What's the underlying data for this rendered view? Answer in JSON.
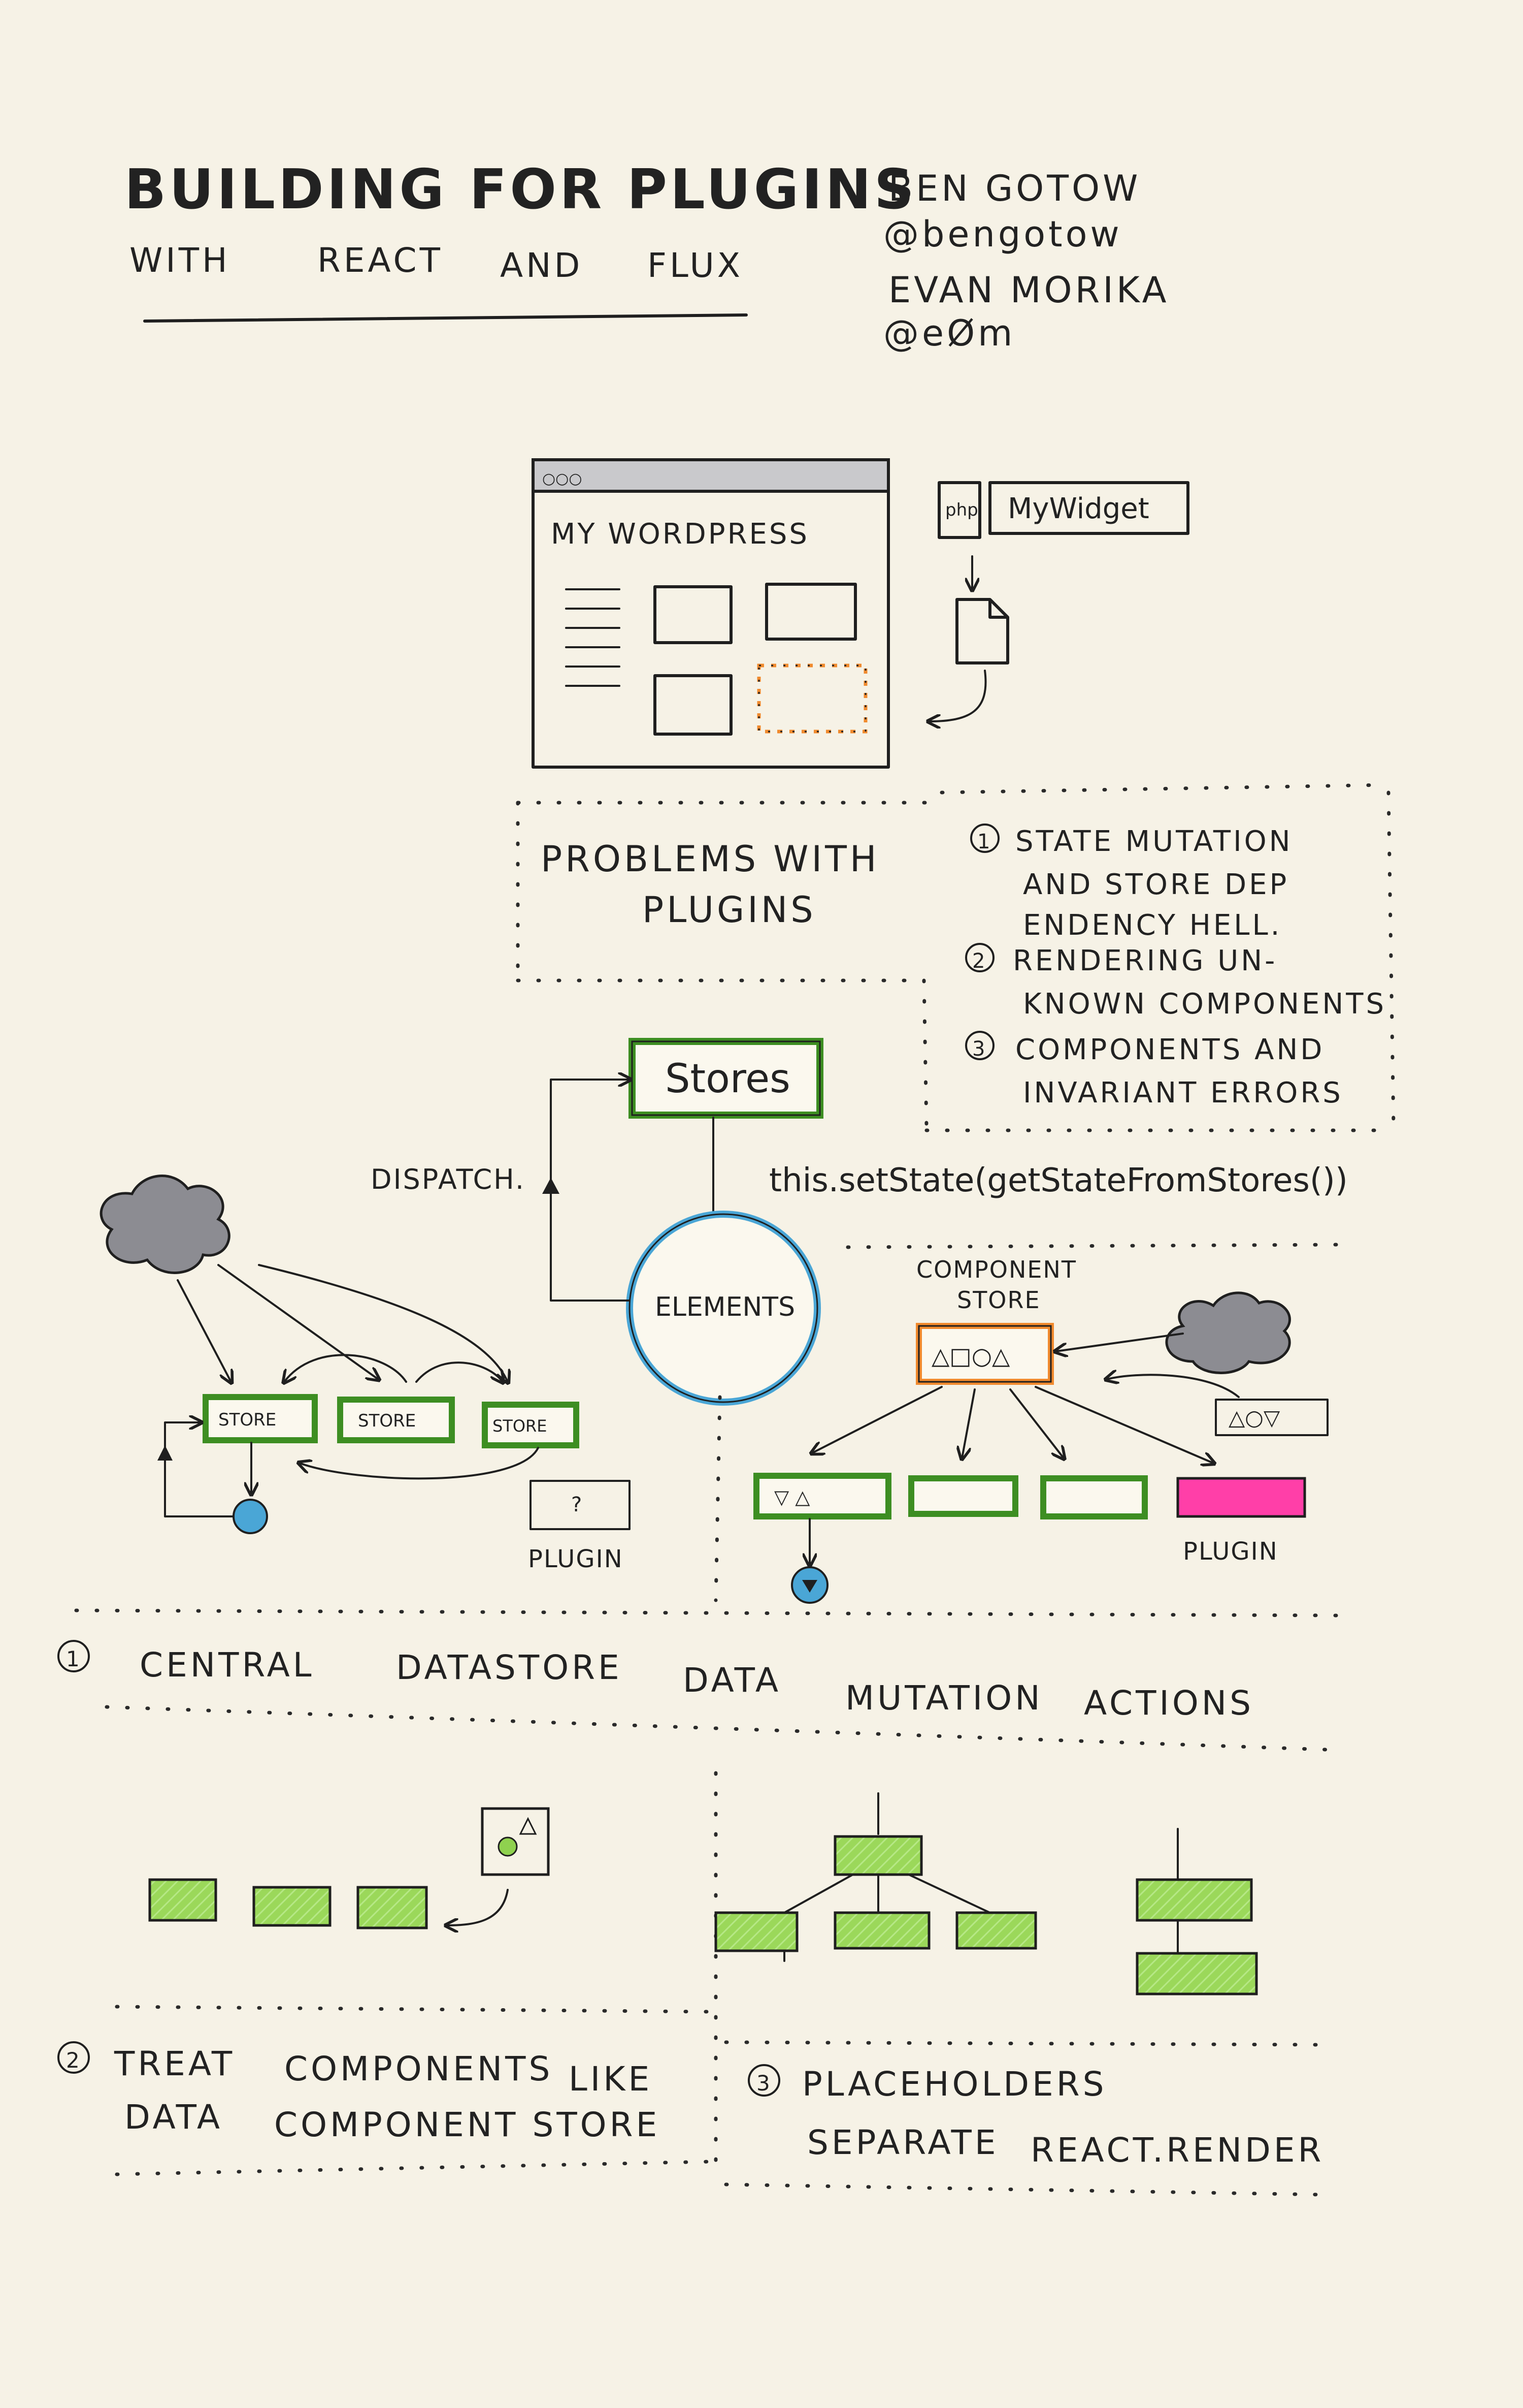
{
  "header": {
    "title": "BUILDING FOR PLUGINS",
    "subtitle_words": [
      "WITH",
      "REACT",
      "AND",
      "FLUX"
    ],
    "authors": [
      {
        "name": "BEN GOTOW",
        "handle": "@bengotow"
      },
      {
        "name": "EVAN MORIKA",
        "handle": "@eØm"
      }
    ]
  },
  "wordpress": {
    "window_title": "MY WORDPRESS",
    "window_dots": "○○○",
    "php_tag": "php",
    "widget_label": "MyWidget"
  },
  "problems": {
    "title_line1": "PROBLEMS WITH",
    "title_line2": "PLUGINS",
    "items": [
      {
        "num": "1",
        "lines": [
          "STATE MUTATION",
          "AND STORE DEP",
          "ENDENCY HELL."
        ]
      },
      {
        "num": "2",
        "lines": [
          "RENDERING UN-",
          "KNOWN COMPONENTS"
        ]
      },
      {
        "num": "3",
        "lines": [
          "COMPONENTS AND",
          "INVARIANT ERRORS"
        ]
      }
    ]
  },
  "flux": {
    "stores_label": "Stores",
    "elements_label": "ELEMENTS",
    "dispatch_label": "DISPATCH.",
    "set_state_label": "this.setState(getStateFromStores())"
  },
  "stores_diagram": {
    "store_labels": [
      "STORE",
      "STORE",
      "STORE"
    ],
    "plugin_box": "?",
    "plugin_label": "PLUGIN"
  },
  "component_store": {
    "title_line1": "COMPONENT",
    "title_line2": "STORE",
    "symbols": "△□○△",
    "plugin_symbols": "△○▽",
    "plugin_label": "PLUGIN",
    "child_symbols": "▽ △"
  },
  "section1": {
    "num": "1",
    "words": [
      "CENTRAL",
      "DATASTORE",
      "DATA",
      "MUTATION",
      "ACTIONS"
    ]
  },
  "section2": {
    "num": "2",
    "line1_words": [
      "TREAT",
      "COMPONENTS",
      "LIKE"
    ],
    "line2_words": [
      "DATA",
      "COMPONENT STORE"
    ]
  },
  "section3": {
    "num": "3",
    "line1": "PLACEHOLDERS",
    "line2_words": [
      "SEPARATE",
      "REACT.RENDER"
    ]
  },
  "colors": {
    "paper": "#f6f2e6",
    "ink": "#1f1f1f",
    "green": "#8fd14f",
    "green_border": "#2f7a1e",
    "blue": "#5bb6dd",
    "orange": "#f08a2e",
    "pink": "#ff3fa8",
    "cloud": "#8c8c92"
  }
}
